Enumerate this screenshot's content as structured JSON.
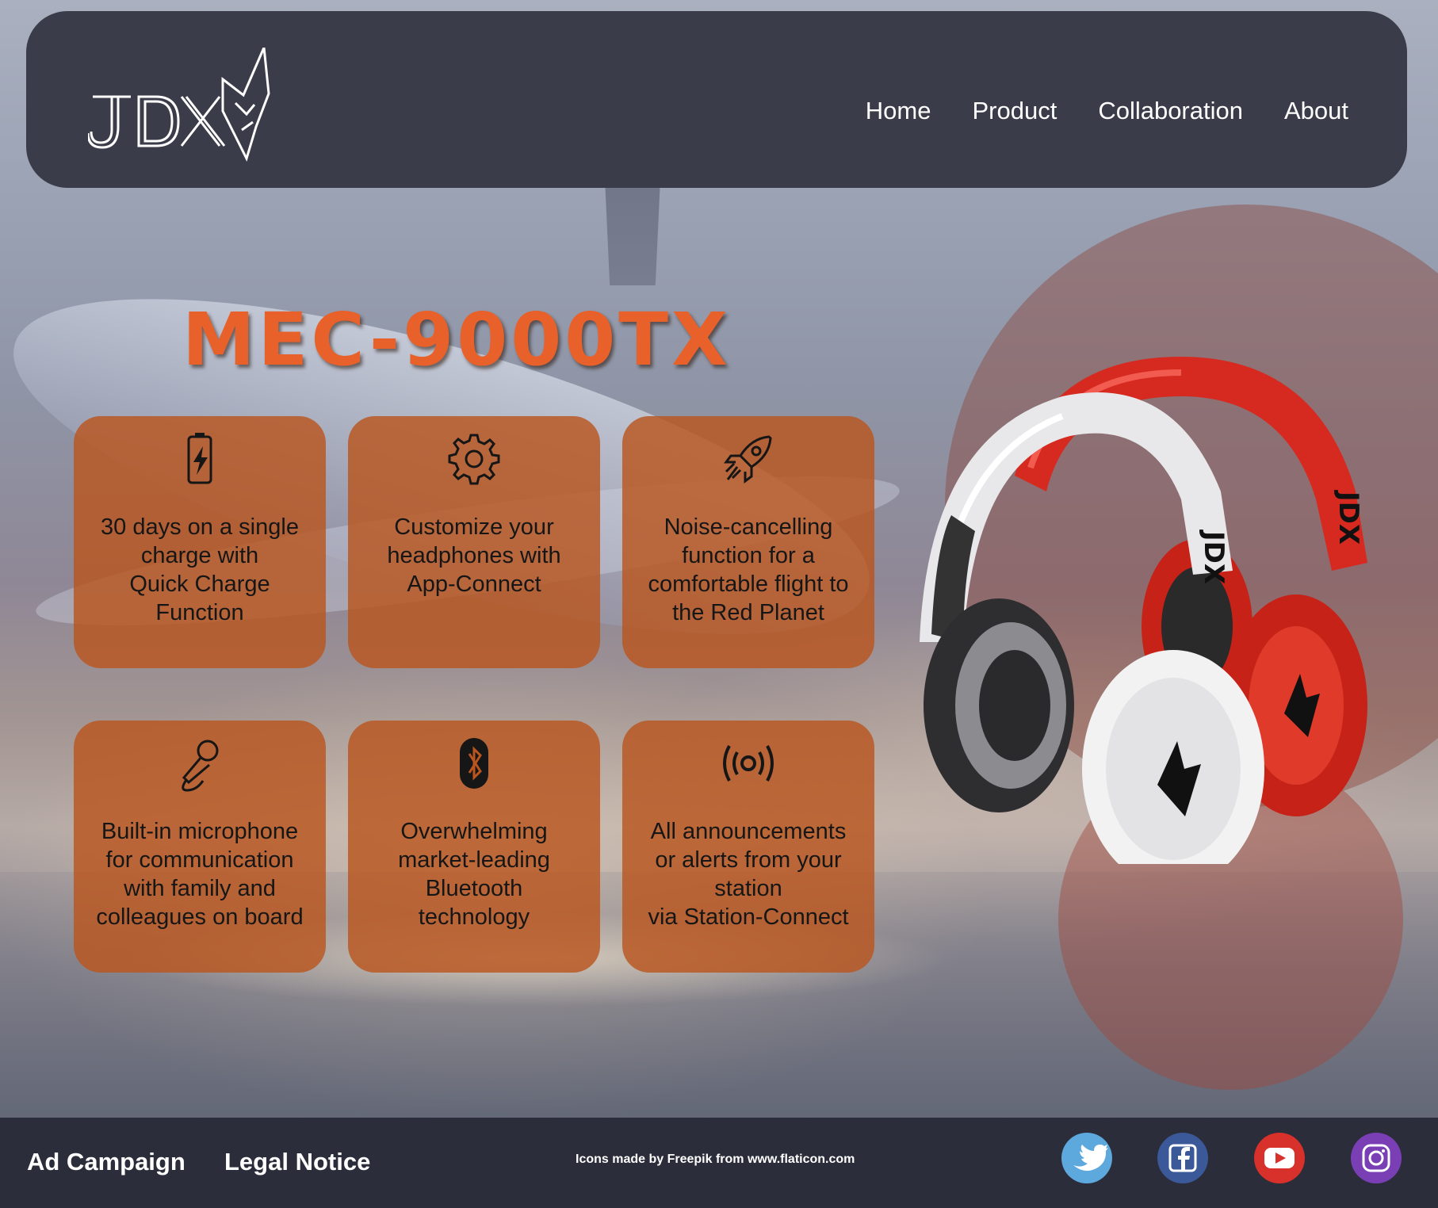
{
  "brand": {
    "logo_text": "JDX"
  },
  "nav": {
    "items": [
      "Home",
      "Product",
      "Collaboration",
      "About"
    ]
  },
  "product": {
    "title": "MEC-9000TX"
  },
  "features": [
    {
      "icon": "battery-charge-icon",
      "text": "30 days on a single\ncharge with\nQuick Charge\nFunction"
    },
    {
      "icon": "gear-icon",
      "text": "Customize your\nheadphones with\nApp-Connect"
    },
    {
      "icon": "rocket-icon",
      "text": "Noise-cancelling\nfunction for a\ncomfortable flight to\nthe Red Planet"
    },
    {
      "icon": "microphone-icon",
      "text": "Built-in microphone\nfor communication\nwith family and\ncolleagues on board"
    },
    {
      "icon": "bluetooth-icon",
      "text": "Overwhelming\nmarket-leading\nBluetooth\ntechnology"
    },
    {
      "icon": "broadcast-icon",
      "text": "All announcements\nor alerts from your\nstation\nvia Station-Connect"
    }
  ],
  "footer": {
    "links": [
      "Ad Campaign",
      "Legal Notice"
    ],
    "credit": "Icons made by Freepik from www.flaticon.com",
    "social": [
      {
        "icon": "twitter-icon",
        "color": "#5da8dc"
      },
      {
        "icon": "facebook-icon",
        "color": "#3b5998"
      },
      {
        "icon": "youtube-icon",
        "color": "#d8302a"
      },
      {
        "icon": "instagram-icon",
        "color": "#7b3fb5"
      }
    ]
  },
  "colors": {
    "accent": "#e8612a",
    "card": "#b9551e",
    "header": "#3a3c4a",
    "footer": "#2b2d3b"
  }
}
